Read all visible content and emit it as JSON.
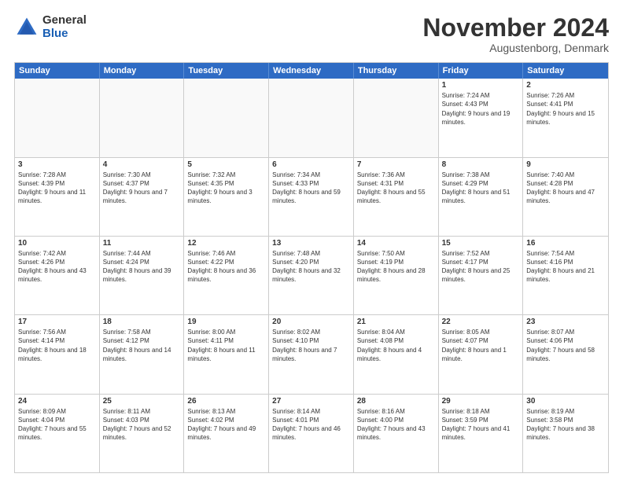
{
  "header": {
    "logo": {
      "general": "General",
      "blue": "Blue"
    },
    "title": "November 2024",
    "location": "Augustenborg, Denmark"
  },
  "calendar": {
    "weekdays": [
      "Sunday",
      "Monday",
      "Tuesday",
      "Wednesday",
      "Thursday",
      "Friday",
      "Saturday"
    ],
    "rows": [
      [
        {
          "day": "",
          "empty": true
        },
        {
          "day": "",
          "empty": true
        },
        {
          "day": "",
          "empty": true
        },
        {
          "day": "",
          "empty": true
        },
        {
          "day": "",
          "empty": true
        },
        {
          "day": "1",
          "sunrise": "7:24 AM",
          "sunset": "4:43 PM",
          "daylight": "9 hours and 19 minutes."
        },
        {
          "day": "2",
          "sunrise": "7:26 AM",
          "sunset": "4:41 PM",
          "daylight": "9 hours and 15 minutes."
        }
      ],
      [
        {
          "day": "3",
          "sunrise": "7:28 AM",
          "sunset": "4:39 PM",
          "daylight": "9 hours and 11 minutes."
        },
        {
          "day": "4",
          "sunrise": "7:30 AM",
          "sunset": "4:37 PM",
          "daylight": "9 hours and 7 minutes."
        },
        {
          "day": "5",
          "sunrise": "7:32 AM",
          "sunset": "4:35 PM",
          "daylight": "9 hours and 3 minutes."
        },
        {
          "day": "6",
          "sunrise": "7:34 AM",
          "sunset": "4:33 PM",
          "daylight": "8 hours and 59 minutes."
        },
        {
          "day": "7",
          "sunrise": "7:36 AM",
          "sunset": "4:31 PM",
          "daylight": "8 hours and 55 minutes."
        },
        {
          "day": "8",
          "sunrise": "7:38 AM",
          "sunset": "4:29 PM",
          "daylight": "8 hours and 51 minutes."
        },
        {
          "day": "9",
          "sunrise": "7:40 AM",
          "sunset": "4:28 PM",
          "daylight": "8 hours and 47 minutes."
        }
      ],
      [
        {
          "day": "10",
          "sunrise": "7:42 AM",
          "sunset": "4:26 PM",
          "daylight": "8 hours and 43 minutes."
        },
        {
          "day": "11",
          "sunrise": "7:44 AM",
          "sunset": "4:24 PM",
          "daylight": "8 hours and 39 minutes."
        },
        {
          "day": "12",
          "sunrise": "7:46 AM",
          "sunset": "4:22 PM",
          "daylight": "8 hours and 36 minutes."
        },
        {
          "day": "13",
          "sunrise": "7:48 AM",
          "sunset": "4:20 PM",
          "daylight": "8 hours and 32 minutes."
        },
        {
          "day": "14",
          "sunrise": "7:50 AM",
          "sunset": "4:19 PM",
          "daylight": "8 hours and 28 minutes."
        },
        {
          "day": "15",
          "sunrise": "7:52 AM",
          "sunset": "4:17 PM",
          "daylight": "8 hours and 25 minutes."
        },
        {
          "day": "16",
          "sunrise": "7:54 AM",
          "sunset": "4:16 PM",
          "daylight": "8 hours and 21 minutes."
        }
      ],
      [
        {
          "day": "17",
          "sunrise": "7:56 AM",
          "sunset": "4:14 PM",
          "daylight": "8 hours and 18 minutes."
        },
        {
          "day": "18",
          "sunrise": "7:58 AM",
          "sunset": "4:12 PM",
          "daylight": "8 hours and 14 minutes."
        },
        {
          "day": "19",
          "sunrise": "8:00 AM",
          "sunset": "4:11 PM",
          "daylight": "8 hours and 11 minutes."
        },
        {
          "day": "20",
          "sunrise": "8:02 AM",
          "sunset": "4:10 PM",
          "daylight": "8 hours and 7 minutes."
        },
        {
          "day": "21",
          "sunrise": "8:04 AM",
          "sunset": "4:08 PM",
          "daylight": "8 hours and 4 minutes."
        },
        {
          "day": "22",
          "sunrise": "8:05 AM",
          "sunset": "4:07 PM",
          "daylight": "8 hours and 1 minute."
        },
        {
          "day": "23",
          "sunrise": "8:07 AM",
          "sunset": "4:06 PM",
          "daylight": "7 hours and 58 minutes."
        }
      ],
      [
        {
          "day": "24",
          "sunrise": "8:09 AM",
          "sunset": "4:04 PM",
          "daylight": "7 hours and 55 minutes."
        },
        {
          "day": "25",
          "sunrise": "8:11 AM",
          "sunset": "4:03 PM",
          "daylight": "7 hours and 52 minutes."
        },
        {
          "day": "26",
          "sunrise": "8:13 AM",
          "sunset": "4:02 PM",
          "daylight": "7 hours and 49 minutes."
        },
        {
          "day": "27",
          "sunrise": "8:14 AM",
          "sunset": "4:01 PM",
          "daylight": "7 hours and 46 minutes."
        },
        {
          "day": "28",
          "sunrise": "8:16 AM",
          "sunset": "4:00 PM",
          "daylight": "7 hours and 43 minutes."
        },
        {
          "day": "29",
          "sunrise": "8:18 AM",
          "sunset": "3:59 PM",
          "daylight": "7 hours and 41 minutes."
        },
        {
          "day": "30",
          "sunrise": "8:19 AM",
          "sunset": "3:58 PM",
          "daylight": "7 hours and 38 minutes."
        }
      ]
    ]
  }
}
